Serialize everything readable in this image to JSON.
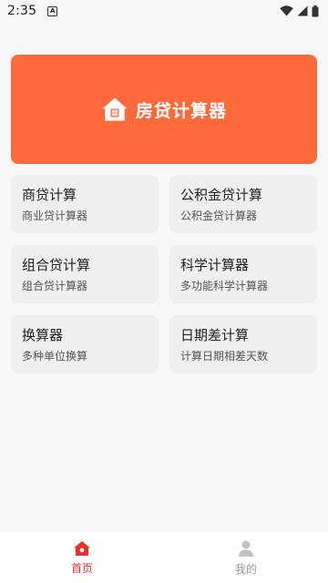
{
  "status_bar": {
    "time": "2:35",
    "notification_letter": "A"
  },
  "hero": {
    "title": "房贷计算器",
    "icon": "house-icon"
  },
  "cards": [
    {
      "title": "商贷计算",
      "subtitle": "商业贷计算器"
    },
    {
      "title": "公积金贷计算",
      "subtitle": "公积金贷计算器"
    },
    {
      "title": "组合贷计算",
      "subtitle": "组合贷计算器"
    },
    {
      "title": "科学计算器",
      "subtitle": "多功能科学计算器"
    },
    {
      "title": "换算器",
      "subtitle": "多种单位换算"
    },
    {
      "title": "日期差计算",
      "subtitle": "计算日期相差天数"
    }
  ],
  "tabbar": {
    "tabs": [
      {
        "label": "首页",
        "icon": "home-icon",
        "active": true
      },
      {
        "label": "我的",
        "icon": "user-icon",
        "active": false
      }
    ]
  },
  "colors": {
    "accent": "#ff6a3d",
    "tab_active": "#e5302c",
    "tab_inactive": "#9a9a9a",
    "card_bg": "#efefef",
    "page_bg": "#f8f8f8"
  }
}
